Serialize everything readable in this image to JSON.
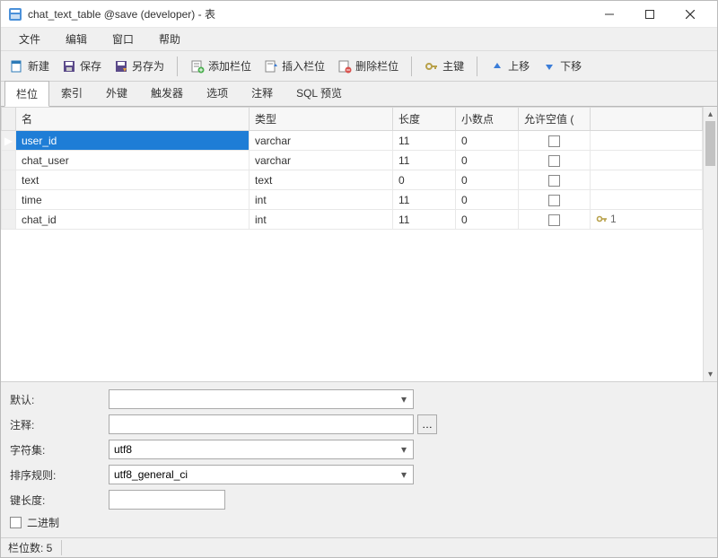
{
  "window": {
    "title": "chat_text_table @save (developer) - 表"
  },
  "menu": {
    "file": "文件",
    "edit": "编辑",
    "window": "窗口",
    "help": "帮助"
  },
  "toolbar": {
    "new": "新建",
    "save": "保存",
    "saveas": "另存为",
    "addcol": "添加栏位",
    "insertcol": "插入栏位",
    "deletecol": "删除栏位",
    "primarykey": "主键",
    "moveup": "上移",
    "movedown": "下移"
  },
  "tabs": {
    "columns": "栏位",
    "indexes": "索引",
    "foreign": "外键",
    "triggers": "触发器",
    "options": "选项",
    "comment": "注释",
    "sqlpreview": "SQL 预览"
  },
  "grid": {
    "headers": {
      "name": "名",
      "type": "类型",
      "length": "长度",
      "decimal": "小数点",
      "allownull": "允许空值 ("
    },
    "rows": [
      {
        "name": "user_id",
        "type": "varchar",
        "length": "11",
        "decimal": "0",
        "pk": ""
      },
      {
        "name": "chat_user",
        "type": "varchar",
        "length": "11",
        "decimal": "0",
        "pk": ""
      },
      {
        "name": "text",
        "type": "text",
        "length": "0",
        "decimal": "0",
        "pk": ""
      },
      {
        "name": "time",
        "type": "int",
        "length": "11",
        "decimal": "0",
        "pk": ""
      },
      {
        "name": "chat_id",
        "type": "int",
        "length": "11",
        "decimal": "0",
        "pk": "1"
      }
    ]
  },
  "props": {
    "default_label": "默认:",
    "default_value": "",
    "comment_label": "注释:",
    "comment_value": "",
    "charset_label": "字符集:",
    "charset_value": "utf8",
    "collation_label": "排序规则:",
    "collation_value": "utf8_general_ci",
    "keylen_label": "键长度:",
    "keylen_value": "",
    "binary_label": "二进制"
  },
  "status": {
    "count": "栏位数: 5"
  }
}
